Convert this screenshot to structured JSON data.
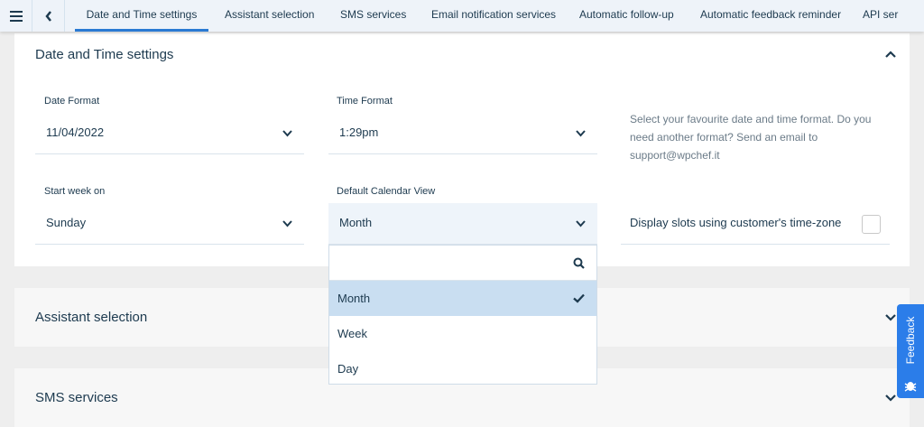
{
  "topbar": {
    "tabs": [
      {
        "label": "Date and Time settings",
        "active": true
      },
      {
        "label": "Assistant selection"
      },
      {
        "label": "SMS services"
      },
      {
        "label": "Email notification services"
      },
      {
        "label": "Automatic follow-up"
      },
      {
        "label": "Automatic feedback reminder"
      },
      {
        "label": "API ser"
      }
    ]
  },
  "datetime": {
    "title": "Date and Time settings",
    "date_format": {
      "label": "Date Format",
      "value": "11/04/2022"
    },
    "time_format": {
      "label": "Time Format",
      "value": "1:29pm"
    },
    "info": "Select your favourite date and time format. Do you need another format? Send an email to support@wpchef.it",
    "start_week": {
      "label": "Start week on",
      "value": "Sunday"
    },
    "calendar_view": {
      "label": "Default Calendar View",
      "value": "Month",
      "search_placeholder": "",
      "options": [
        "Month",
        "Week",
        "Day"
      ],
      "selected": "Month"
    },
    "customer_tz": {
      "label": "Display slots using customer's time-zone",
      "checked": false
    }
  },
  "sections": [
    {
      "title": "Assistant selection"
    },
    {
      "title": "SMS services"
    }
  ],
  "feedback": {
    "label": "Feedback",
    "color": "#2b7de9"
  },
  "colors": {
    "accent": "#2a7ad3",
    "selected_option": "#c9def1"
  }
}
